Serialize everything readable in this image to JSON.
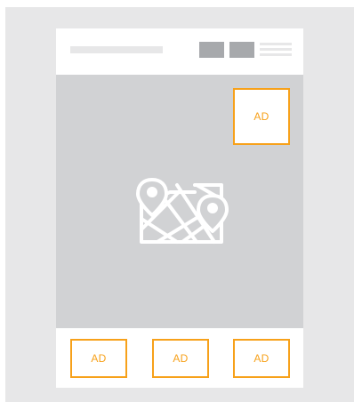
{
  "colors": {
    "outer_background": "#e7e7e8",
    "device_background": "#ffffff",
    "header_placeholder": "#e7e7e8",
    "header_buttons": "#a7a9ac",
    "map_background": "#d1d2d4",
    "map_icon": "#ffffff",
    "ad_accent": "#f7a11a"
  },
  "icons": {
    "map": "map-with-location-pins-icon",
    "menu": "menu-lines-icon"
  },
  "ads": {
    "top_right": "AD",
    "bottom_left": "AD",
    "bottom_center": "AD",
    "bottom_right": "AD"
  }
}
